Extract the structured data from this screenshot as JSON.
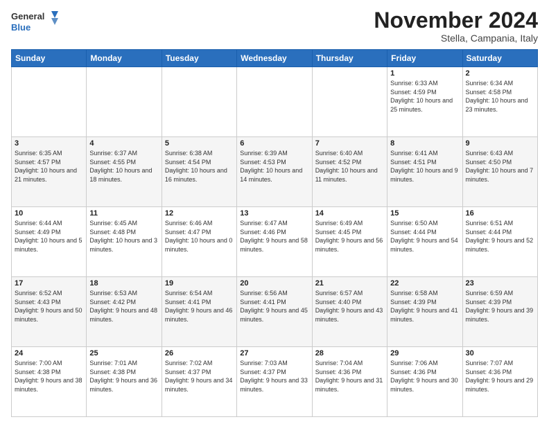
{
  "logo": {
    "line1": "General",
    "line2": "Blue"
  },
  "header": {
    "title": "November 2024",
    "subtitle": "Stella, Campania, Italy"
  },
  "weekdays": [
    "Sunday",
    "Monday",
    "Tuesday",
    "Wednesday",
    "Thursday",
    "Friday",
    "Saturday"
  ],
  "weeks": [
    [
      {
        "day": "",
        "info": ""
      },
      {
        "day": "",
        "info": ""
      },
      {
        "day": "",
        "info": ""
      },
      {
        "day": "",
        "info": ""
      },
      {
        "day": "",
        "info": ""
      },
      {
        "day": "1",
        "info": "Sunrise: 6:33 AM\nSunset: 4:59 PM\nDaylight: 10 hours and 25 minutes."
      },
      {
        "day": "2",
        "info": "Sunrise: 6:34 AM\nSunset: 4:58 PM\nDaylight: 10 hours and 23 minutes."
      }
    ],
    [
      {
        "day": "3",
        "info": "Sunrise: 6:35 AM\nSunset: 4:57 PM\nDaylight: 10 hours and 21 minutes."
      },
      {
        "day": "4",
        "info": "Sunrise: 6:37 AM\nSunset: 4:55 PM\nDaylight: 10 hours and 18 minutes."
      },
      {
        "day": "5",
        "info": "Sunrise: 6:38 AM\nSunset: 4:54 PM\nDaylight: 10 hours and 16 minutes."
      },
      {
        "day": "6",
        "info": "Sunrise: 6:39 AM\nSunset: 4:53 PM\nDaylight: 10 hours and 14 minutes."
      },
      {
        "day": "7",
        "info": "Sunrise: 6:40 AM\nSunset: 4:52 PM\nDaylight: 10 hours and 11 minutes."
      },
      {
        "day": "8",
        "info": "Sunrise: 6:41 AM\nSunset: 4:51 PM\nDaylight: 10 hours and 9 minutes."
      },
      {
        "day": "9",
        "info": "Sunrise: 6:43 AM\nSunset: 4:50 PM\nDaylight: 10 hours and 7 minutes."
      }
    ],
    [
      {
        "day": "10",
        "info": "Sunrise: 6:44 AM\nSunset: 4:49 PM\nDaylight: 10 hours and 5 minutes."
      },
      {
        "day": "11",
        "info": "Sunrise: 6:45 AM\nSunset: 4:48 PM\nDaylight: 10 hours and 3 minutes."
      },
      {
        "day": "12",
        "info": "Sunrise: 6:46 AM\nSunset: 4:47 PM\nDaylight: 10 hours and 0 minutes."
      },
      {
        "day": "13",
        "info": "Sunrise: 6:47 AM\nSunset: 4:46 PM\nDaylight: 9 hours and 58 minutes."
      },
      {
        "day": "14",
        "info": "Sunrise: 6:49 AM\nSunset: 4:45 PM\nDaylight: 9 hours and 56 minutes."
      },
      {
        "day": "15",
        "info": "Sunrise: 6:50 AM\nSunset: 4:44 PM\nDaylight: 9 hours and 54 minutes."
      },
      {
        "day": "16",
        "info": "Sunrise: 6:51 AM\nSunset: 4:44 PM\nDaylight: 9 hours and 52 minutes."
      }
    ],
    [
      {
        "day": "17",
        "info": "Sunrise: 6:52 AM\nSunset: 4:43 PM\nDaylight: 9 hours and 50 minutes."
      },
      {
        "day": "18",
        "info": "Sunrise: 6:53 AM\nSunset: 4:42 PM\nDaylight: 9 hours and 48 minutes."
      },
      {
        "day": "19",
        "info": "Sunrise: 6:54 AM\nSunset: 4:41 PM\nDaylight: 9 hours and 46 minutes."
      },
      {
        "day": "20",
        "info": "Sunrise: 6:56 AM\nSunset: 4:41 PM\nDaylight: 9 hours and 45 minutes."
      },
      {
        "day": "21",
        "info": "Sunrise: 6:57 AM\nSunset: 4:40 PM\nDaylight: 9 hours and 43 minutes."
      },
      {
        "day": "22",
        "info": "Sunrise: 6:58 AM\nSunset: 4:39 PM\nDaylight: 9 hours and 41 minutes."
      },
      {
        "day": "23",
        "info": "Sunrise: 6:59 AM\nSunset: 4:39 PM\nDaylight: 9 hours and 39 minutes."
      }
    ],
    [
      {
        "day": "24",
        "info": "Sunrise: 7:00 AM\nSunset: 4:38 PM\nDaylight: 9 hours and 38 minutes."
      },
      {
        "day": "25",
        "info": "Sunrise: 7:01 AM\nSunset: 4:38 PM\nDaylight: 9 hours and 36 minutes."
      },
      {
        "day": "26",
        "info": "Sunrise: 7:02 AM\nSunset: 4:37 PM\nDaylight: 9 hours and 34 minutes."
      },
      {
        "day": "27",
        "info": "Sunrise: 7:03 AM\nSunset: 4:37 PM\nDaylight: 9 hours and 33 minutes."
      },
      {
        "day": "28",
        "info": "Sunrise: 7:04 AM\nSunset: 4:36 PM\nDaylight: 9 hours and 31 minutes."
      },
      {
        "day": "29",
        "info": "Sunrise: 7:06 AM\nSunset: 4:36 PM\nDaylight: 9 hours and 30 minutes."
      },
      {
        "day": "30",
        "info": "Sunrise: 7:07 AM\nSunset: 4:36 PM\nDaylight: 9 hours and 29 minutes."
      }
    ]
  ]
}
